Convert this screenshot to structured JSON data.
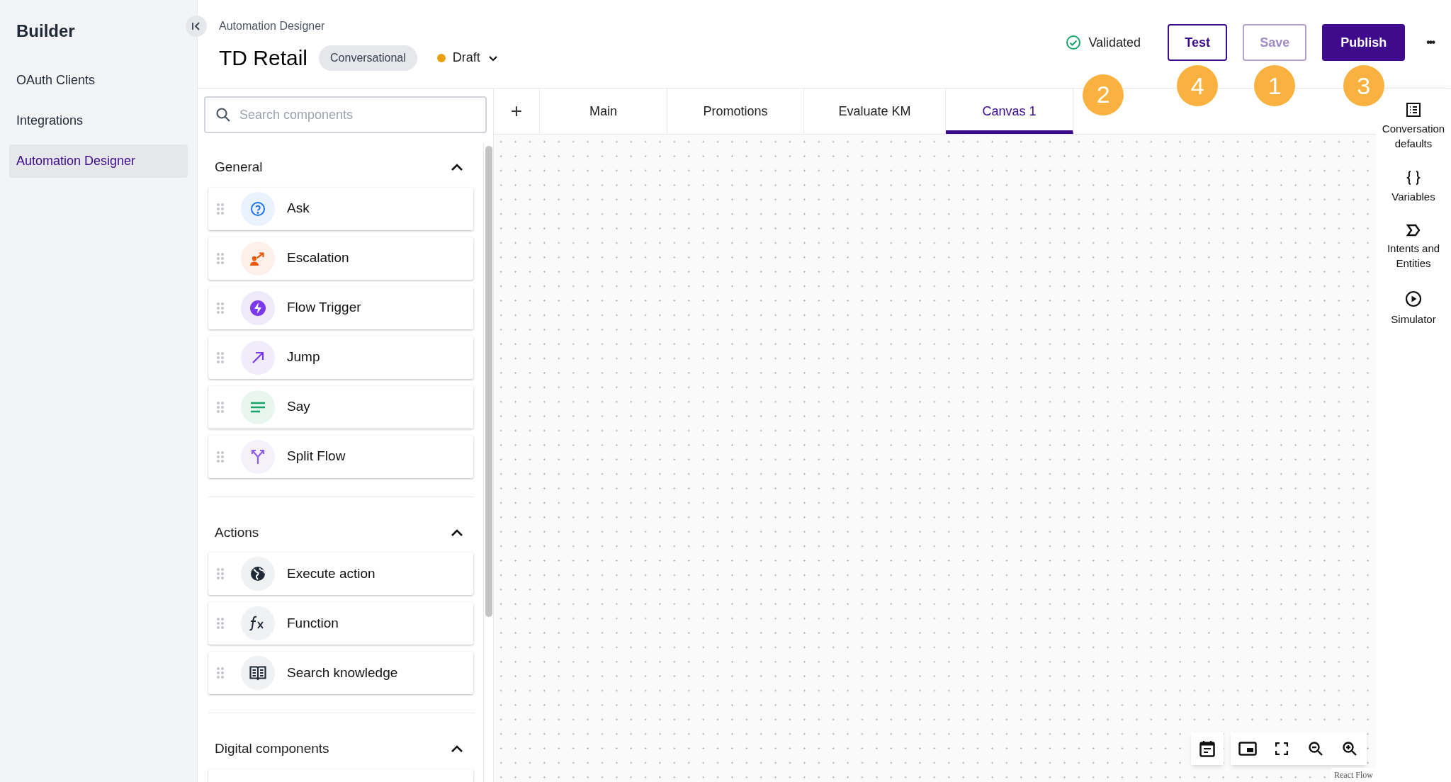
{
  "nav": {
    "title": "Builder",
    "items": [
      {
        "label": "OAuth Clients",
        "selected": false
      },
      {
        "label": "Integrations",
        "selected": false
      },
      {
        "label": "Automation Designer",
        "selected": true
      }
    ]
  },
  "header": {
    "breadcrumb": "Automation Designer",
    "title": "TD Retail",
    "tag": "Conversational",
    "status": "Draft",
    "validation": {
      "label": "Validated",
      "callout": "2"
    },
    "buttons": [
      {
        "label": "Test",
        "kind": "outline",
        "disabled": false,
        "callout": "4"
      },
      {
        "label": "Save",
        "kind": "outline",
        "disabled": true,
        "callout": "1"
      },
      {
        "label": "Publish",
        "kind": "primary",
        "disabled": false,
        "callout": "3"
      }
    ],
    "more": "•••"
  },
  "search": {
    "placeholder": "Search components"
  },
  "sections": [
    {
      "title": "General",
      "expanded": true,
      "items": [
        {
          "label": "Ask",
          "kind": "question",
          "color": "#1a73e8"
        },
        {
          "label": "Escalation",
          "kind": "escalate",
          "color": "#e8590c"
        },
        {
          "label": "Flow Trigger",
          "kind": "bolt",
          "color": "#7c3aed"
        },
        {
          "label": "Jump",
          "kind": "arrow",
          "color": "#7c3aed"
        },
        {
          "label": "Say",
          "kind": "lines",
          "color": "#16a36a"
        },
        {
          "label": "Split Flow",
          "kind": "split",
          "color": "#8b5cf6"
        }
      ]
    },
    {
      "title": "Actions",
      "expanded": true,
      "items": [
        {
          "label": "Execute action",
          "kind": "globe",
          "color": "#1f2937"
        },
        {
          "label": "Function",
          "kind": "fx",
          "color": "#1f2937"
        },
        {
          "label": "Search knowledge",
          "kind": "book",
          "color": "#1f2937"
        }
      ]
    },
    {
      "title": "Digital components",
      "expanded": true
    }
  ],
  "tabs": [
    {
      "label": "Main",
      "selected": false
    },
    {
      "label": "Promotions",
      "selected": false
    },
    {
      "label": "Evaluate KM",
      "selected": false
    },
    {
      "label": "Canvas 1",
      "selected": true
    }
  ],
  "add_tab": "+",
  "right_panel": [
    {
      "label": "Conversation defaults",
      "kind": "list"
    },
    {
      "label": "Variables",
      "kind": "braces"
    },
    {
      "label": "Intents and Entities",
      "kind": "tag"
    },
    {
      "label": "Simulator",
      "kind": "play"
    }
  ],
  "attribution": "React Flow"
}
